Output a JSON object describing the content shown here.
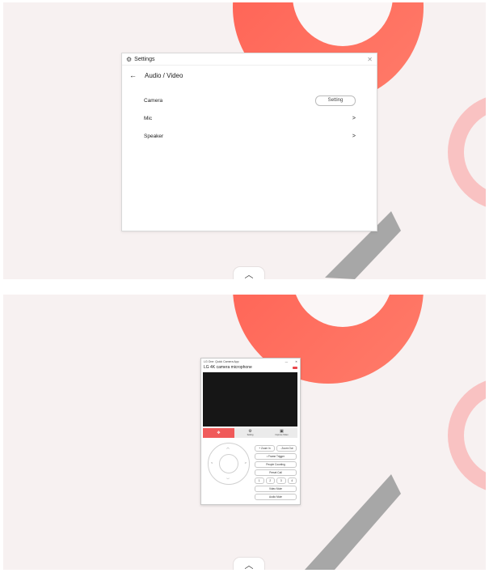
{
  "settings": {
    "title": "Settings",
    "page": "Audio / Video",
    "items": [
      {
        "label": "Camera",
        "action": "Setting"
      },
      {
        "label": "Mic",
        "chevron": ">"
      },
      {
        "label": "Speaker",
        "chevron": ">"
      }
    ]
  },
  "camera_app": {
    "title": "LG One: Quick Camera App",
    "device": "LG 4K camera microphone",
    "tabs": [
      "",
      "Setting",
      "Improve Video"
    ],
    "buttons": {
      "zoom_in": "+ Zoom In",
      "zoom_out": "- Zoom Out",
      "auto_frame": "• Frame Trigger",
      "people_counting": "People Counting",
      "preset_call": "Preset Call",
      "presets": [
        "1",
        "2",
        "3",
        "4"
      ],
      "video_mute": "Video Mute",
      "audio_mute": "Audio Mute"
    }
  },
  "icons": {
    "expand": "chevron-up-icon",
    "settings": "gear-icon",
    "back": "arrow-left-icon",
    "close": "close-icon"
  },
  "colors": {
    "accent": "#f05a5a",
    "background": "#f7f1f1",
    "ring": "#ff6f5e",
    "arc": "#a7a7a7"
  }
}
